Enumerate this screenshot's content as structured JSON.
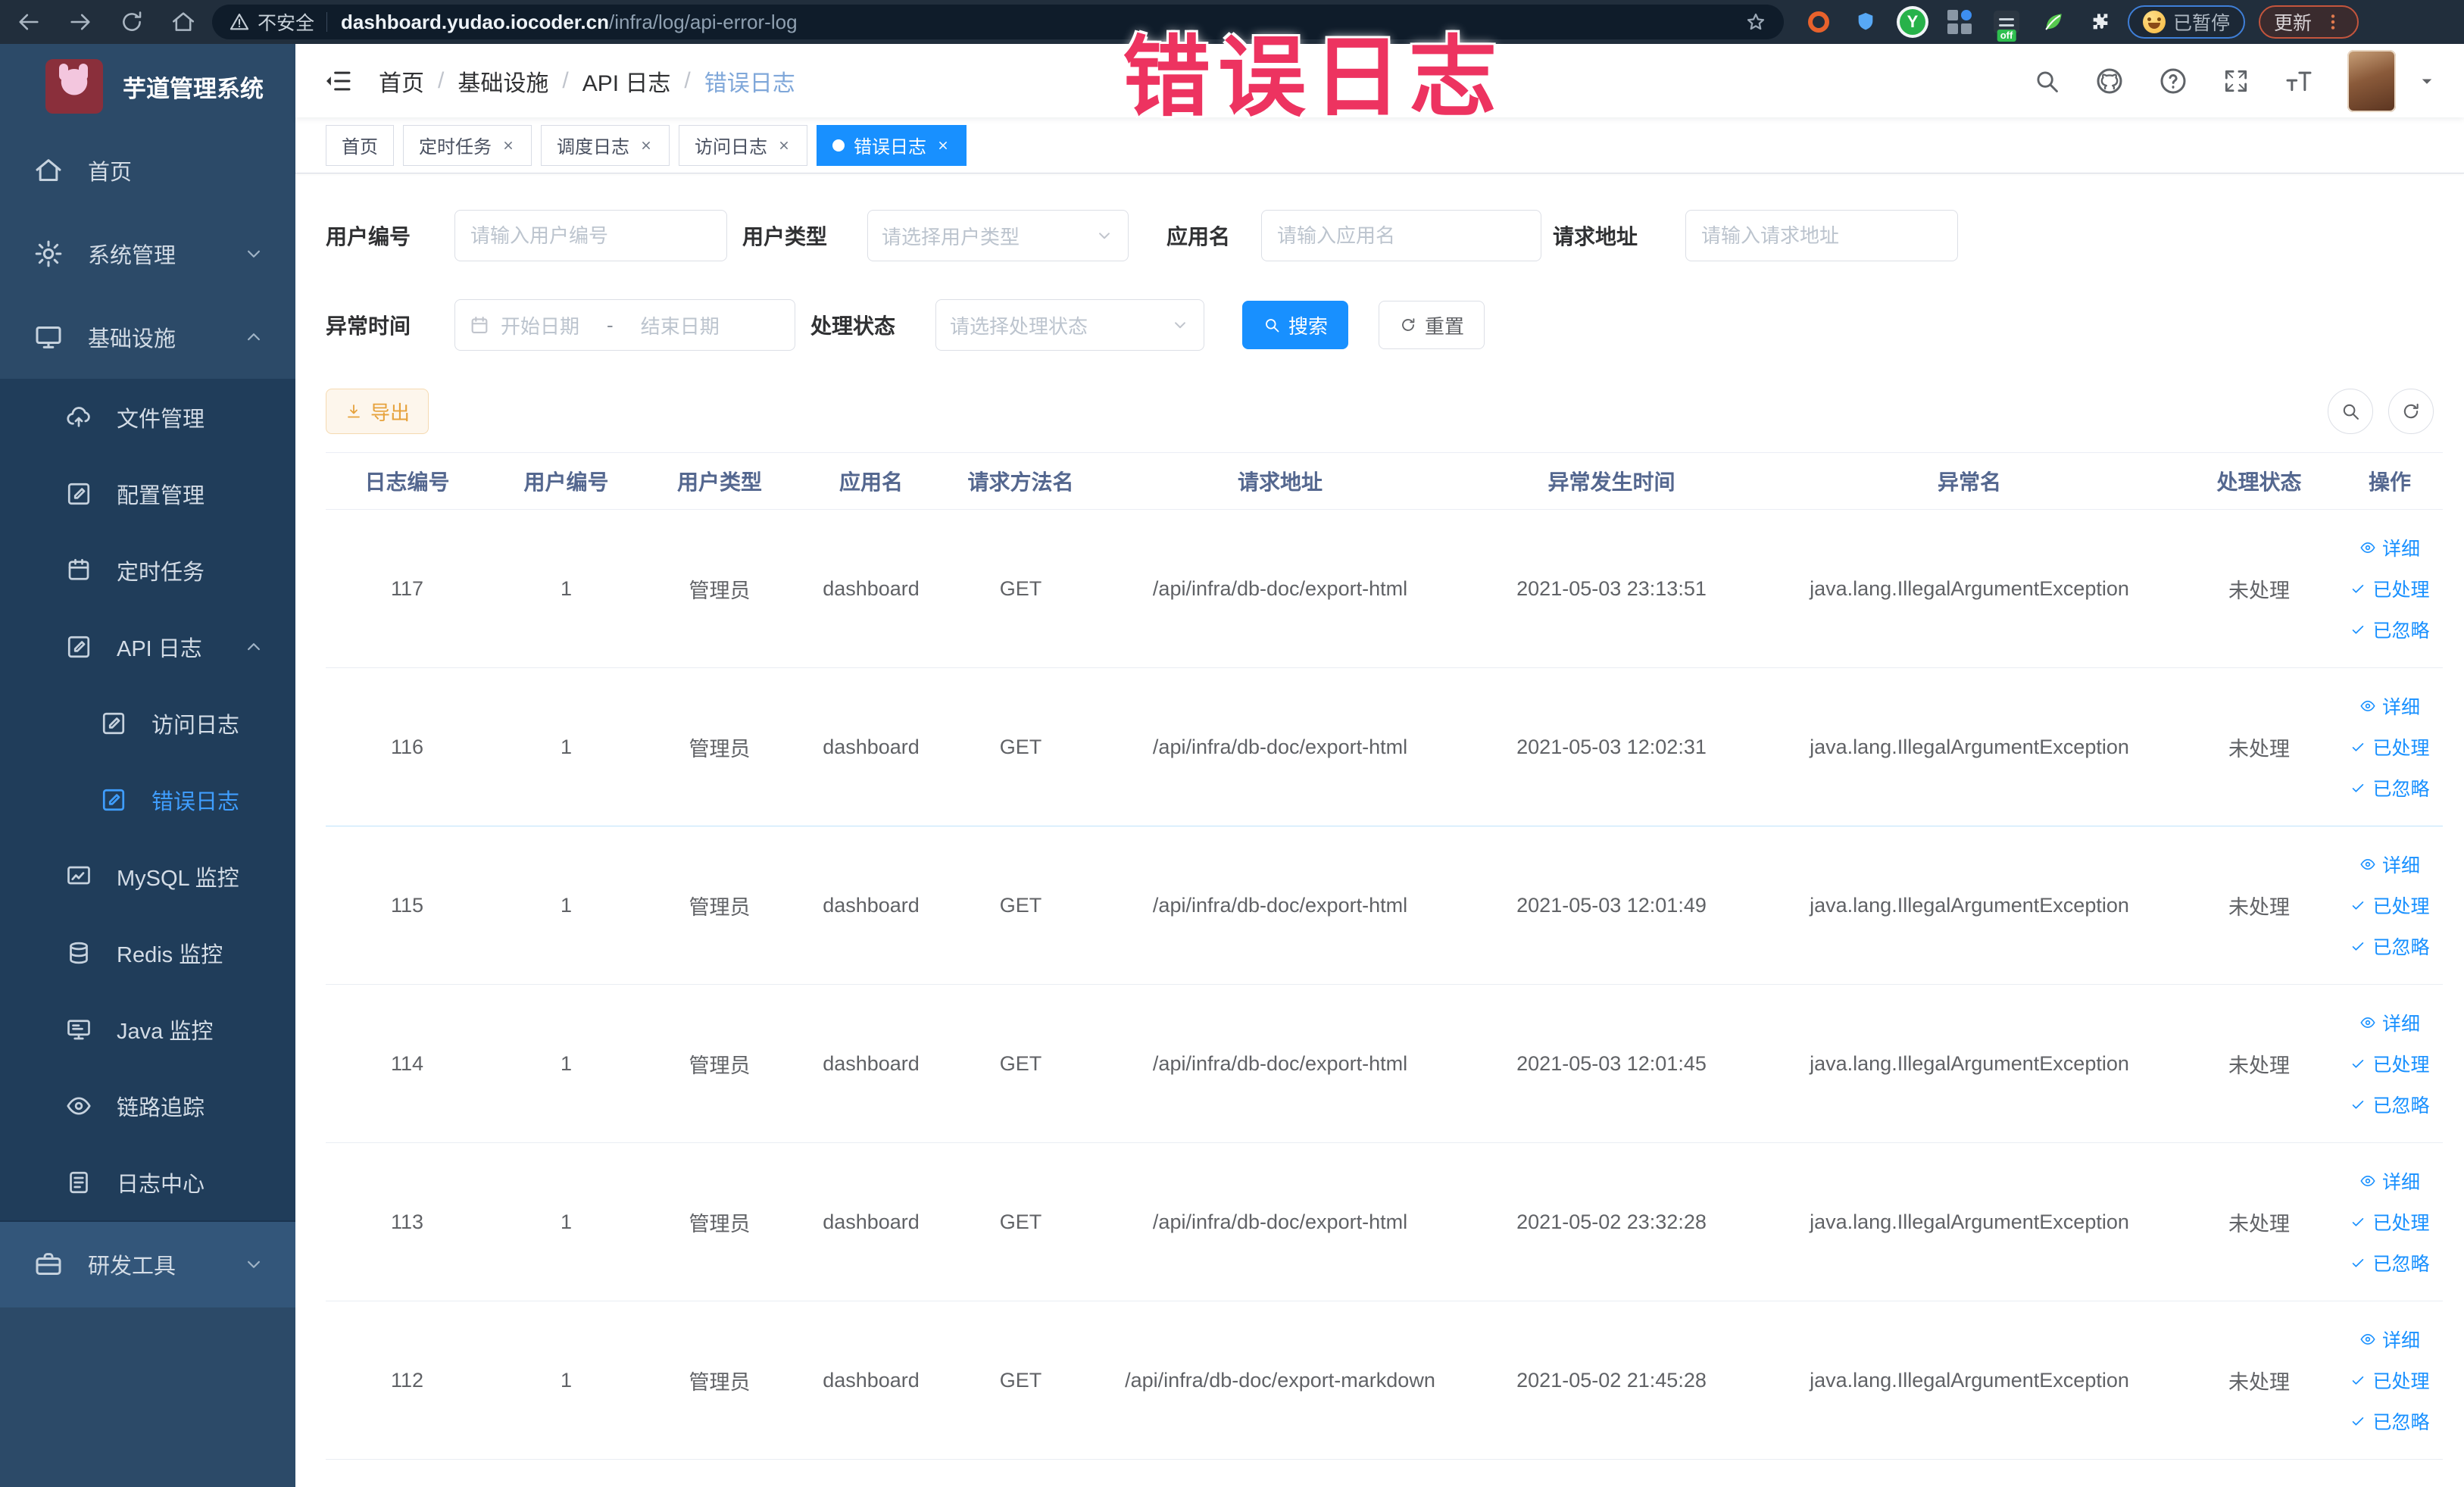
{
  "browser": {
    "security_label": "不安全",
    "url_host": "dashboard.yudao.iocoder.cn",
    "url_path": "/infra/log/api-error-log",
    "onoff_badge": "off",
    "paused_badge": "已暂停",
    "update_button": "更新"
  },
  "overlay": {
    "text": "错误日志",
    "color": "#ed3360"
  },
  "sidebar": {
    "title": "芋道管理系统",
    "items": [
      {
        "label": "首页",
        "icon": "home",
        "level": 1
      },
      {
        "label": "系统管理",
        "icon": "gear",
        "level": 1,
        "chevron": "down"
      },
      {
        "label": "基础设施",
        "icon": "infra",
        "level": 1,
        "chevron": "up"
      },
      {
        "label": "文件管理",
        "icon": "cloud-upload",
        "level": 2,
        "group": "sub"
      },
      {
        "label": "配置管理",
        "icon": "edit-square",
        "level": 2,
        "group": "sub"
      },
      {
        "label": "定时任务",
        "icon": "cron",
        "level": 2,
        "group": "sub"
      },
      {
        "label": "API 日志",
        "icon": "edit-square",
        "level": 2,
        "chevron": "up",
        "group": "sub"
      },
      {
        "label": "访问日志",
        "icon": "edit-square",
        "level": 3,
        "group": "sub"
      },
      {
        "label": "错误日志",
        "icon": "edit-square",
        "level": 3,
        "group": "sub",
        "active": true
      },
      {
        "label": "MySQL 监控",
        "icon": "chart",
        "level": 2,
        "group": "sub"
      },
      {
        "label": "Redis 监控",
        "icon": "database",
        "level": 2,
        "group": "sub"
      },
      {
        "label": "Java 监控",
        "icon": "monitor",
        "level": 2,
        "group": "sub"
      },
      {
        "label": "链路追踪",
        "icon": "eye",
        "level": 2,
        "group": "sub"
      },
      {
        "label": "日志中心",
        "icon": "doc",
        "level": 2,
        "group": "sub"
      },
      {
        "label": "研发工具",
        "icon": "toolbox",
        "level": 1,
        "chevron": "down",
        "group": "band"
      }
    ]
  },
  "header": {
    "breadcrumb": [
      "首页",
      "基础设施",
      "API 日志",
      "错误日志"
    ]
  },
  "tabs": [
    {
      "label": "首页",
      "closable": false,
      "active": false
    },
    {
      "label": "定时任务",
      "closable": true,
      "active": false
    },
    {
      "label": "调度日志",
      "closable": true,
      "active": false
    },
    {
      "label": "访问日志",
      "closable": true,
      "active": false
    },
    {
      "label": "错误日志",
      "closable": true,
      "active": true
    }
  ],
  "filters": {
    "user_id_label": "用户编号",
    "user_id_placeholder": "请输入用户编号",
    "user_type_label": "用户类型",
    "user_type_placeholder": "请选择用户类型",
    "app_name_label": "应用名",
    "app_name_placeholder": "请输入应用名",
    "request_url_label": "请求地址",
    "request_url_placeholder": "请输入请求地址",
    "exception_time_label": "异常时间",
    "start_date_placeholder": "开始日期",
    "range_separator": "-",
    "end_date_placeholder": "结束日期",
    "process_status_label": "处理状态",
    "process_status_placeholder": "请选择处理状态",
    "search_button": "搜索",
    "reset_button": "重置"
  },
  "toolbar": {
    "export_button": "导出"
  },
  "table": {
    "columns": [
      "日志编号",
      "用户编号",
      "用户类型",
      "应用名",
      "请求方法名",
      "请求地址",
      "异常发生时间",
      "异常名",
      "处理状态",
      "操作"
    ],
    "actions": [
      {
        "icon": "eye",
        "label": "详细"
      },
      {
        "icon": "check",
        "label": "已处理"
      },
      {
        "icon": "check",
        "label": "已忽略"
      }
    ],
    "rows": [
      {
        "id": "117",
        "user_id": "1",
        "user_type": "管理员",
        "app": "dashboard",
        "method": "GET",
        "url": "/api/infra/db-doc/export-html",
        "time": "2021-05-03 23:13:51",
        "exception": "java.lang.IllegalArgumentException",
        "status": "未处理"
      },
      {
        "id": "116",
        "user_id": "1",
        "user_type": "管理员",
        "app": "dashboard",
        "method": "GET",
        "url": "/api/infra/db-doc/export-html",
        "time": "2021-05-03 12:02:31",
        "exception": "java.lang.IllegalArgumentException",
        "status": "未处理"
      },
      {
        "id": "115",
        "user_id": "1",
        "user_type": "管理员",
        "app": "dashboard",
        "method": "GET",
        "url": "/api/infra/db-doc/export-html",
        "time": "2021-05-03 12:01:49",
        "exception": "java.lang.IllegalArgumentException",
        "status": "未处理"
      },
      {
        "id": "114",
        "user_id": "1",
        "user_type": "管理员",
        "app": "dashboard",
        "method": "GET",
        "url": "/api/infra/db-doc/export-html",
        "time": "2021-05-03 12:01:45",
        "exception": "java.lang.IllegalArgumentException",
        "status": "未处理"
      },
      {
        "id": "113",
        "user_id": "1",
        "user_type": "管理员",
        "app": "dashboard",
        "method": "GET",
        "url": "/api/infra/db-doc/export-html",
        "time": "2021-05-02 23:32:28",
        "exception": "java.lang.IllegalArgumentException",
        "status": "未处理"
      },
      {
        "id": "112",
        "user_id": "1",
        "user_type": "管理员",
        "app": "dashboard",
        "method": "GET",
        "url": "/api/infra/db-doc/export-markdown",
        "time": "2021-05-02 21:45:28",
        "exception": "java.lang.IllegalArgumentException",
        "status": "未处理"
      }
    ]
  }
}
